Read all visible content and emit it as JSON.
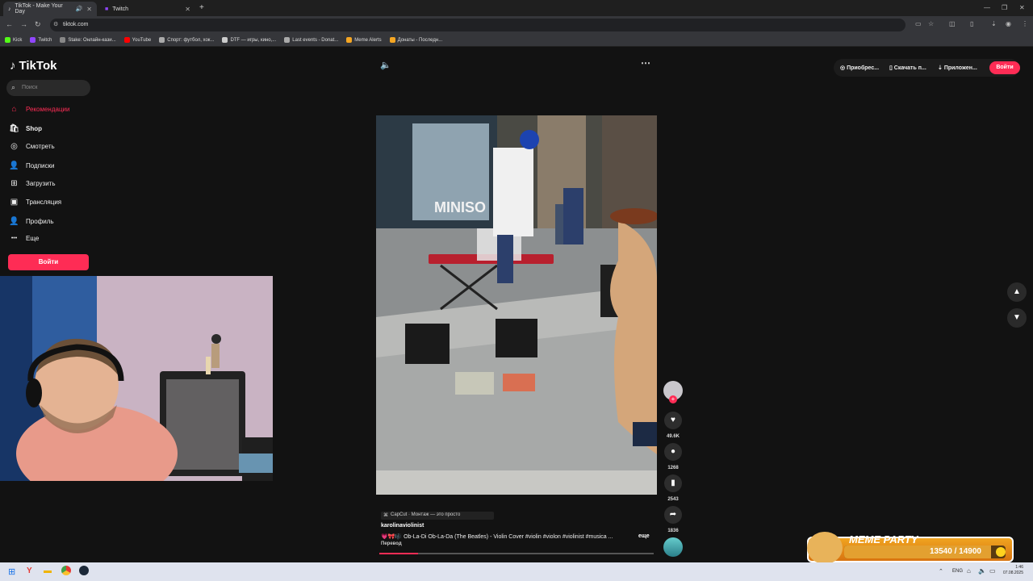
{
  "browser": {
    "tabs": [
      {
        "title": "TikTok - Make Your Day",
        "active": true
      },
      {
        "title": "Twitch",
        "active": false
      }
    ],
    "new_tab": "+",
    "url": "tiktok.com",
    "bookmarks": [
      {
        "label": "Kick",
        "color": "#53fc18"
      },
      {
        "label": "Twitch",
        "color": "#9146ff"
      },
      {
        "label": "Stake: Онлайн-кази...",
        "color": "#888888"
      },
      {
        "label": "YouTube",
        "color": "#ff0000"
      },
      {
        "label": "Спорт: футбол, хок...",
        "color": "#aaaaaa"
      },
      {
        "label": "DTF — игры, кино,...",
        "color": "#cccccc"
      },
      {
        "label": "Last events - Donat...",
        "color": "#aaaaaa"
      },
      {
        "label": "Meme Alerts",
        "color": "#f5a623"
      },
      {
        "label": "Донаты - Последн...",
        "color": "#f5a623"
      }
    ]
  },
  "tiktok": {
    "logo": "TikTok",
    "search_placeholder": "Поиск",
    "nav": [
      {
        "label": "Рекомендации",
        "icon": "home-icon"
      },
      {
        "label": "Shop",
        "icon": "shop-icon"
      },
      {
        "label": "Смотреть",
        "icon": "compass-icon"
      },
      {
        "label": "Подписки",
        "icon": "following-icon"
      },
      {
        "label": "Загрузить",
        "icon": "upload-icon"
      },
      {
        "label": "Трансляция",
        "icon": "live-icon"
      },
      {
        "label": "Профиль",
        "icon": "profile-icon"
      },
      {
        "label": "Еще",
        "icon": "more-icon"
      }
    ],
    "login": "Войти",
    "top_right": {
      "coins": "Приобрес...",
      "download": "Скачать п...",
      "app": "Приложен...",
      "login": "Войти"
    },
    "video": {
      "capcut": "CapCut · Монтаж — это просто",
      "author": "karolinaviolinist",
      "caption": "💗🎀🎼 Ob-La-Di Ob-La-Da (The Beatles) - Violin Cover #violin #violon #violinist #musica ...",
      "more": "еще",
      "translate": "Перевод",
      "progress": 0.14,
      "likes": "49.6K",
      "comments": "1268",
      "saves": "2543",
      "shares": "1836"
    }
  },
  "overlay": {
    "meme_title": "MEME PARTY",
    "meme_progress_text": "13540 / 14900",
    "meme_progress": 0.909
  },
  "taskbar": {
    "lang": "ENG",
    "time": "1:46",
    "date": "07.08.2025"
  }
}
